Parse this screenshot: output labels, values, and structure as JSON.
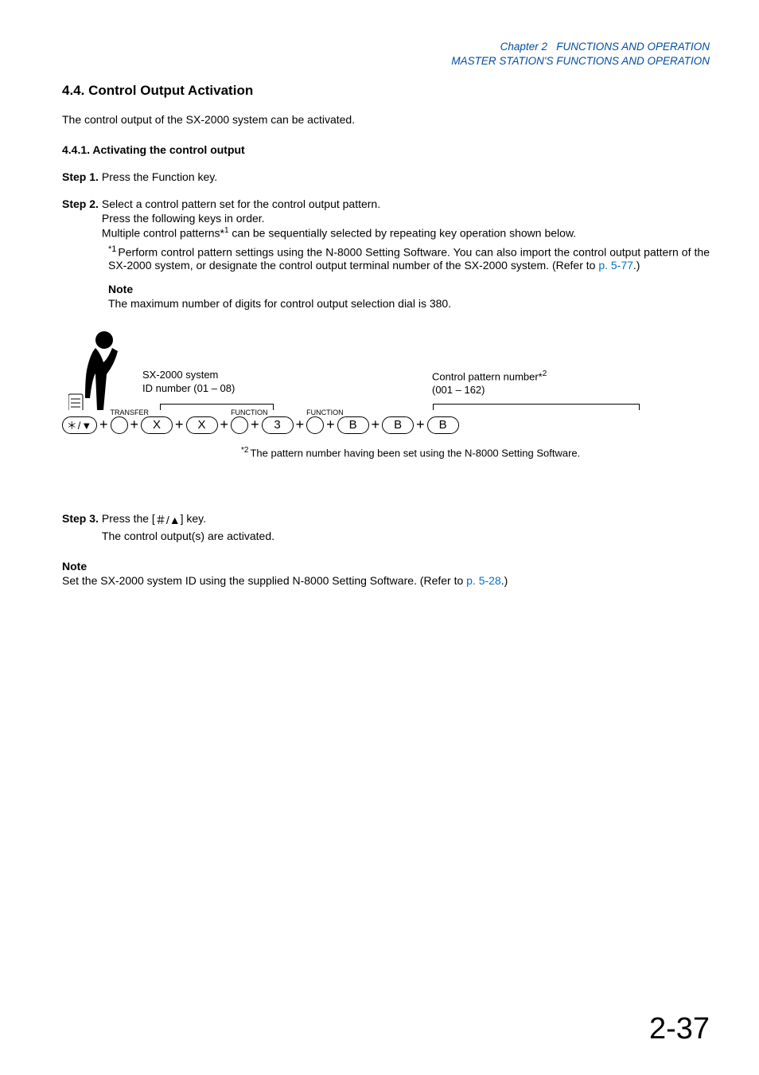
{
  "header": {
    "chapter_line1_prefix": "Chapter 2",
    "chapter_line1_rest": "FUNCTIONS AND OPERATION",
    "chapter_line2": "MASTER STATION'S FUNCTIONS AND OPERATION"
  },
  "section": {
    "number": "4.4.",
    "title": "Control Output Activation"
  },
  "intro": "The control output of the SX-2000 system can be activated.",
  "subsection": {
    "number": "4.4.1.",
    "title": "Activating the control output"
  },
  "steps": {
    "s1": {
      "label": "Step 1.",
      "text": "Press the Function key."
    },
    "s2": {
      "label": "Step 2.",
      "l1": "Select a control pattern set for the control output pattern.",
      "l2": "Press the following keys in order.",
      "l3a": "Multiple control patterns*",
      "l3sup": "1",
      "l3b": " can be sequentially selected by repeating key operation shown below."
    },
    "s3": {
      "label": "Step 3.",
      "l1a": "Press the [",
      "l1b": "] key.",
      "l2": "The control output(s) are activated."
    }
  },
  "footnotes": {
    "fn1_sup": "*1",
    "fn1_a": "Perform control pattern settings using the N-8000 Setting Software. You can also import the control output pattern of the SX-2000 system, or designate the control output terminal number of the SX-2000 system. (Refer to ",
    "fn1_link": "p. 5-77",
    "fn1_b": ".)",
    "fn2_sup": "*2",
    "fn2_text": "The pattern number having been set using the N-8000 Setting Software."
  },
  "notes": {
    "note1_label": "Note",
    "note1_body": "The maximum number of digits for control output selection dial is 380.",
    "note2_label": "Note",
    "note2_a": "Set the SX-2000 system ID using the supplied N-8000 Setting Software. (Refer to ",
    "note2_link": "p. 5-28",
    "note2_b": ".)"
  },
  "diagram": {
    "annot1_l1": "SX-2000 system",
    "annot1_l2": "ID number (01 – 08)",
    "annot2_l1": "Control pattern number*",
    "annot2_sup": "2",
    "annot2_l2": "(001 – 162)",
    "transfer_label": "TRANSFER",
    "function_label": "FUNCTION",
    "keys": {
      "k0": "＊/▼",
      "kX": "X",
      "k3": "3",
      "kB": "B",
      "kHash": "＃/▲"
    }
  },
  "page_number": "2-37"
}
